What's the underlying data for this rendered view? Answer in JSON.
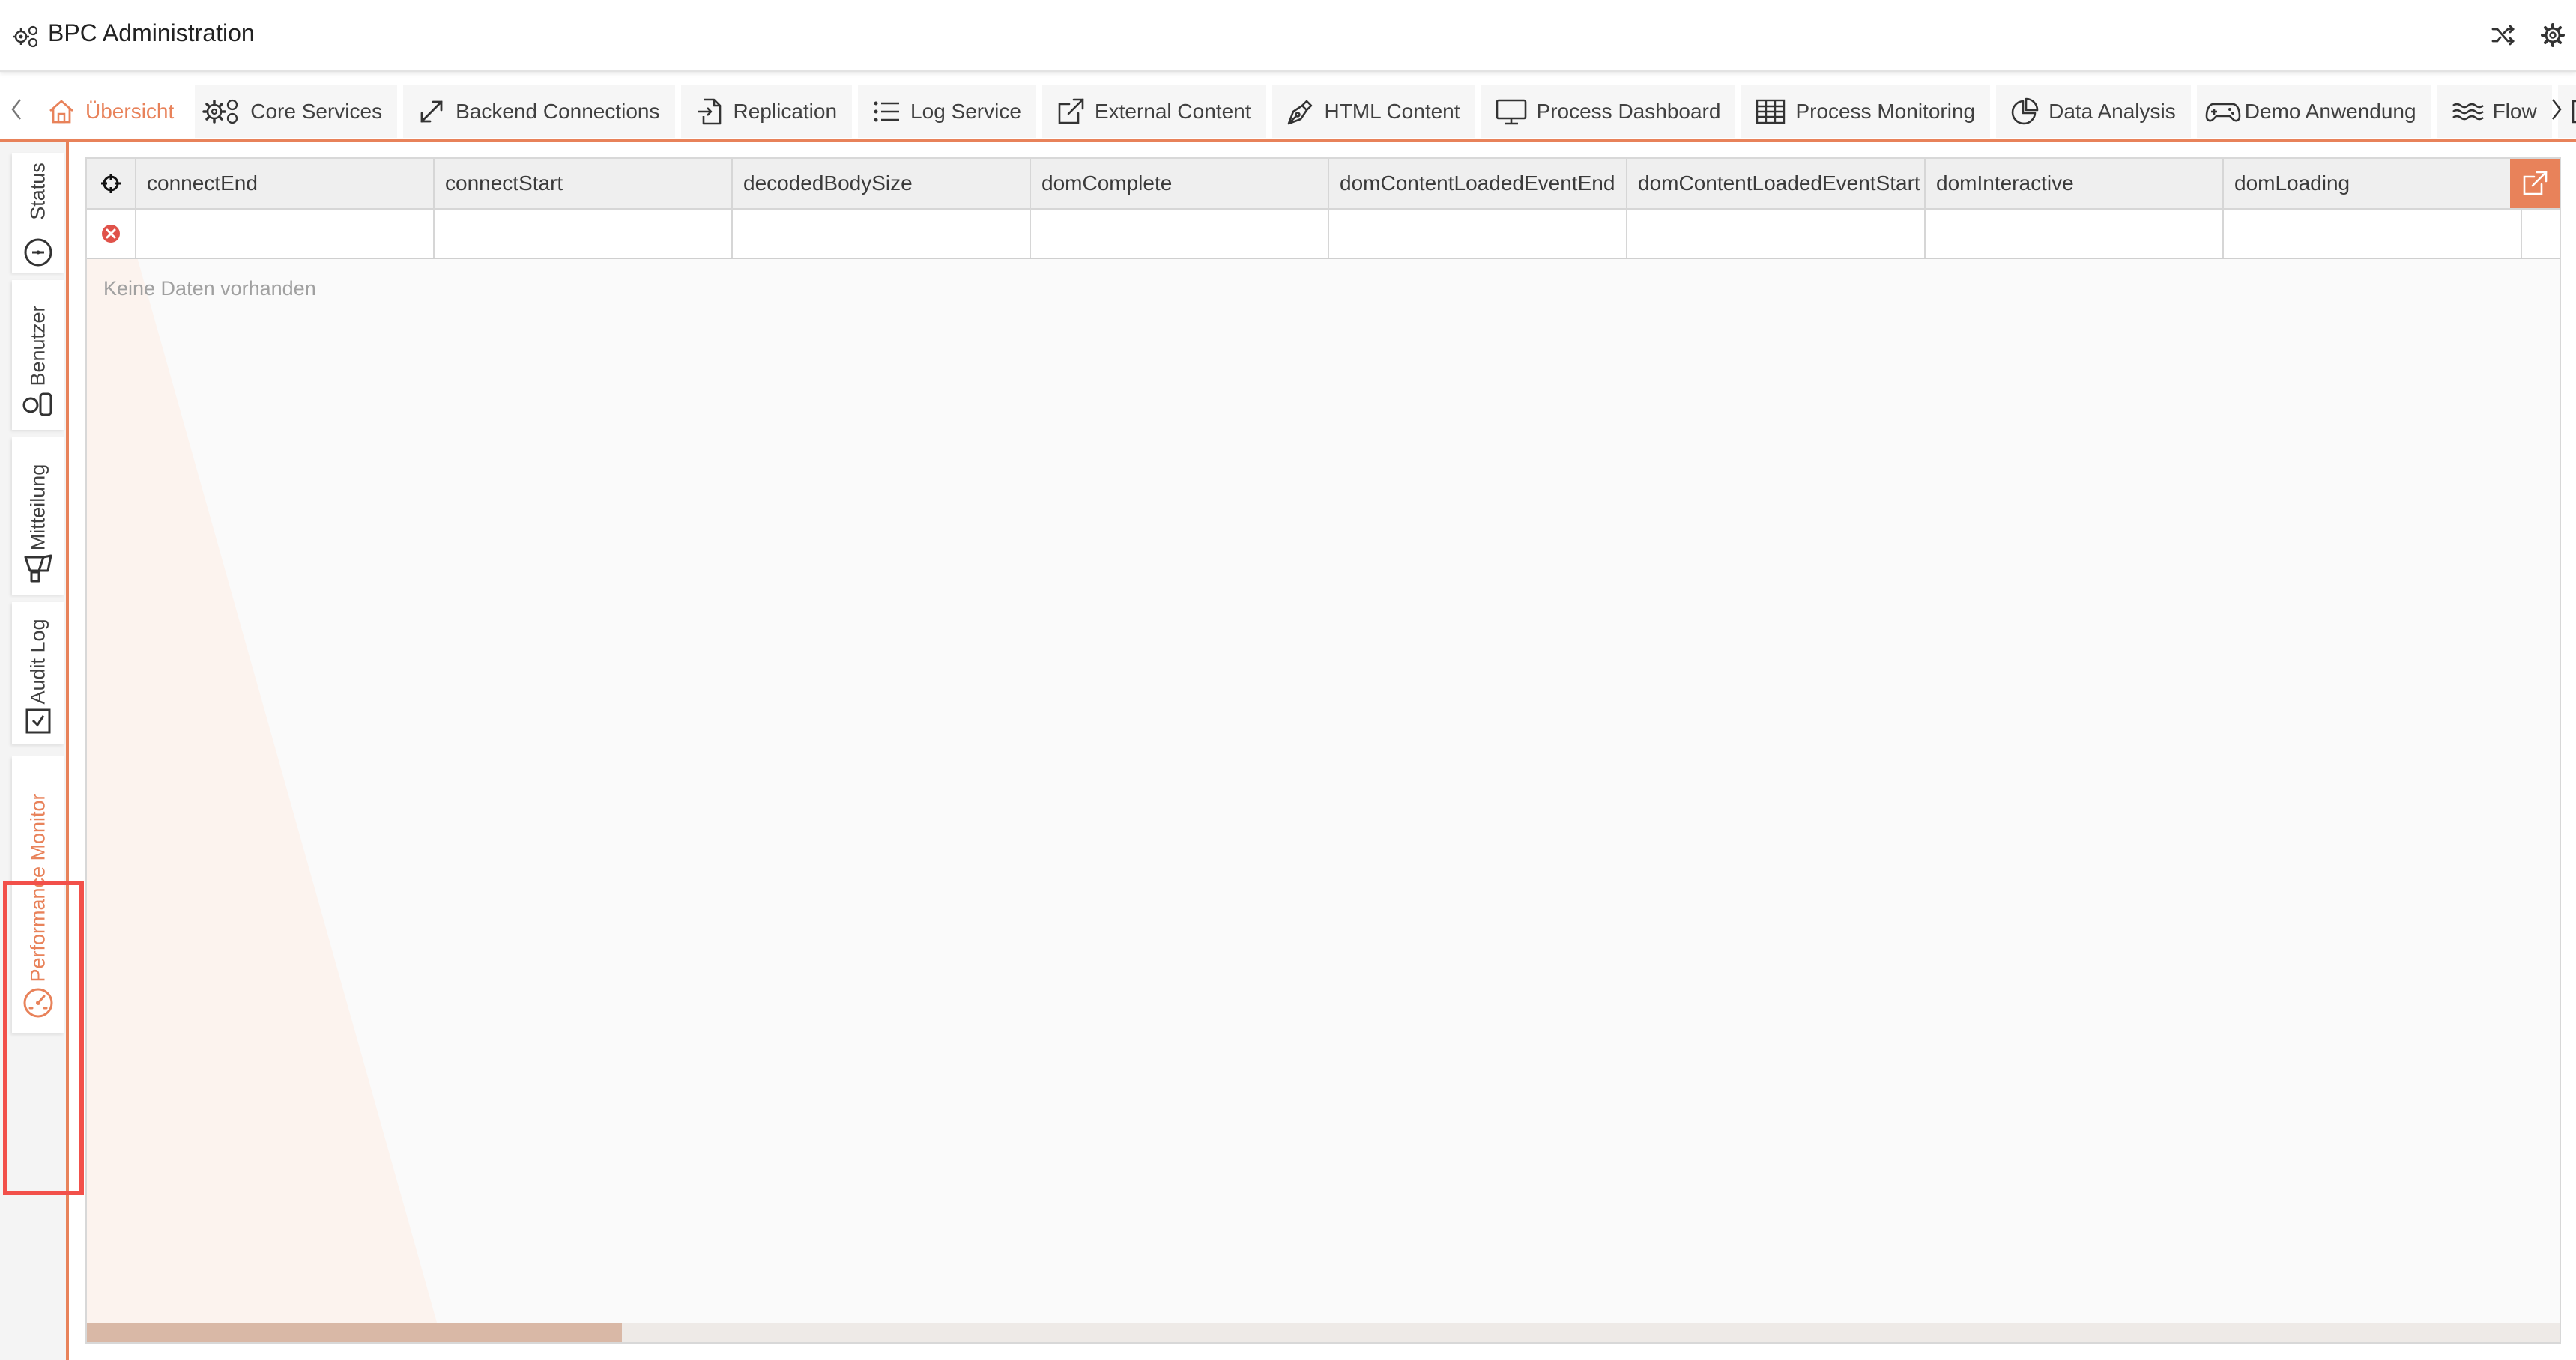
{
  "header": {
    "title": "BPC Administration",
    "app_icon": "gears-icon",
    "buttons": [
      {
        "name": "shuffle-icon"
      },
      {
        "name": "settings-gear-icon"
      }
    ]
  },
  "tabs": [
    {
      "label": "Übersicht",
      "icon": "home-icon",
      "active": true
    },
    {
      "label": "Core Services",
      "icon": "gears-icon"
    },
    {
      "label": "Backend Connections",
      "icon": "expand-arrows-icon"
    },
    {
      "label": "Replication",
      "icon": "file-import-icon"
    },
    {
      "label": "Log Service",
      "icon": "list-icon"
    },
    {
      "label": "External Content",
      "icon": "external-link-icon"
    },
    {
      "label": "HTML Content",
      "icon": "pen-nib-icon"
    },
    {
      "label": "Process Dashboard",
      "icon": "monitor-icon"
    },
    {
      "label": "Process Monitoring",
      "icon": "table-icon"
    },
    {
      "label": "Data Analysis",
      "icon": "pie-chart-icon"
    },
    {
      "label": "Demo Anwendung",
      "icon": "gamepad-icon"
    },
    {
      "label": "Flow",
      "icon": "waves-icon"
    }
  ],
  "side_tabs": [
    {
      "label": "Status",
      "icon": "info-circle-icon"
    },
    {
      "label": "Benutzer",
      "icon": "user-toggle-icon"
    },
    {
      "label": "Mitteilung",
      "icon": "megaphone-icon"
    },
    {
      "label": "Audit Log",
      "icon": "log-book-icon"
    },
    {
      "label": "Performance Monitor",
      "icon": "speedometer-icon",
      "active": true
    }
  ],
  "grid": {
    "columns": [
      "connectEnd",
      "connectStart",
      "decodedBodySize",
      "domComplete",
      "domContentLoadedEventEnd",
      "domContentLoadedEventStart",
      "domInteractive",
      "domLoading"
    ],
    "empty_message": "Keine Daten vorhanden",
    "select_icon": "crosshair-icon",
    "clear_filter_icon": "clear-filter-icon",
    "export_icon": "export-icon"
  },
  "colors": {
    "accent": "#e8825a",
    "highlight": "#f2504a"
  }
}
